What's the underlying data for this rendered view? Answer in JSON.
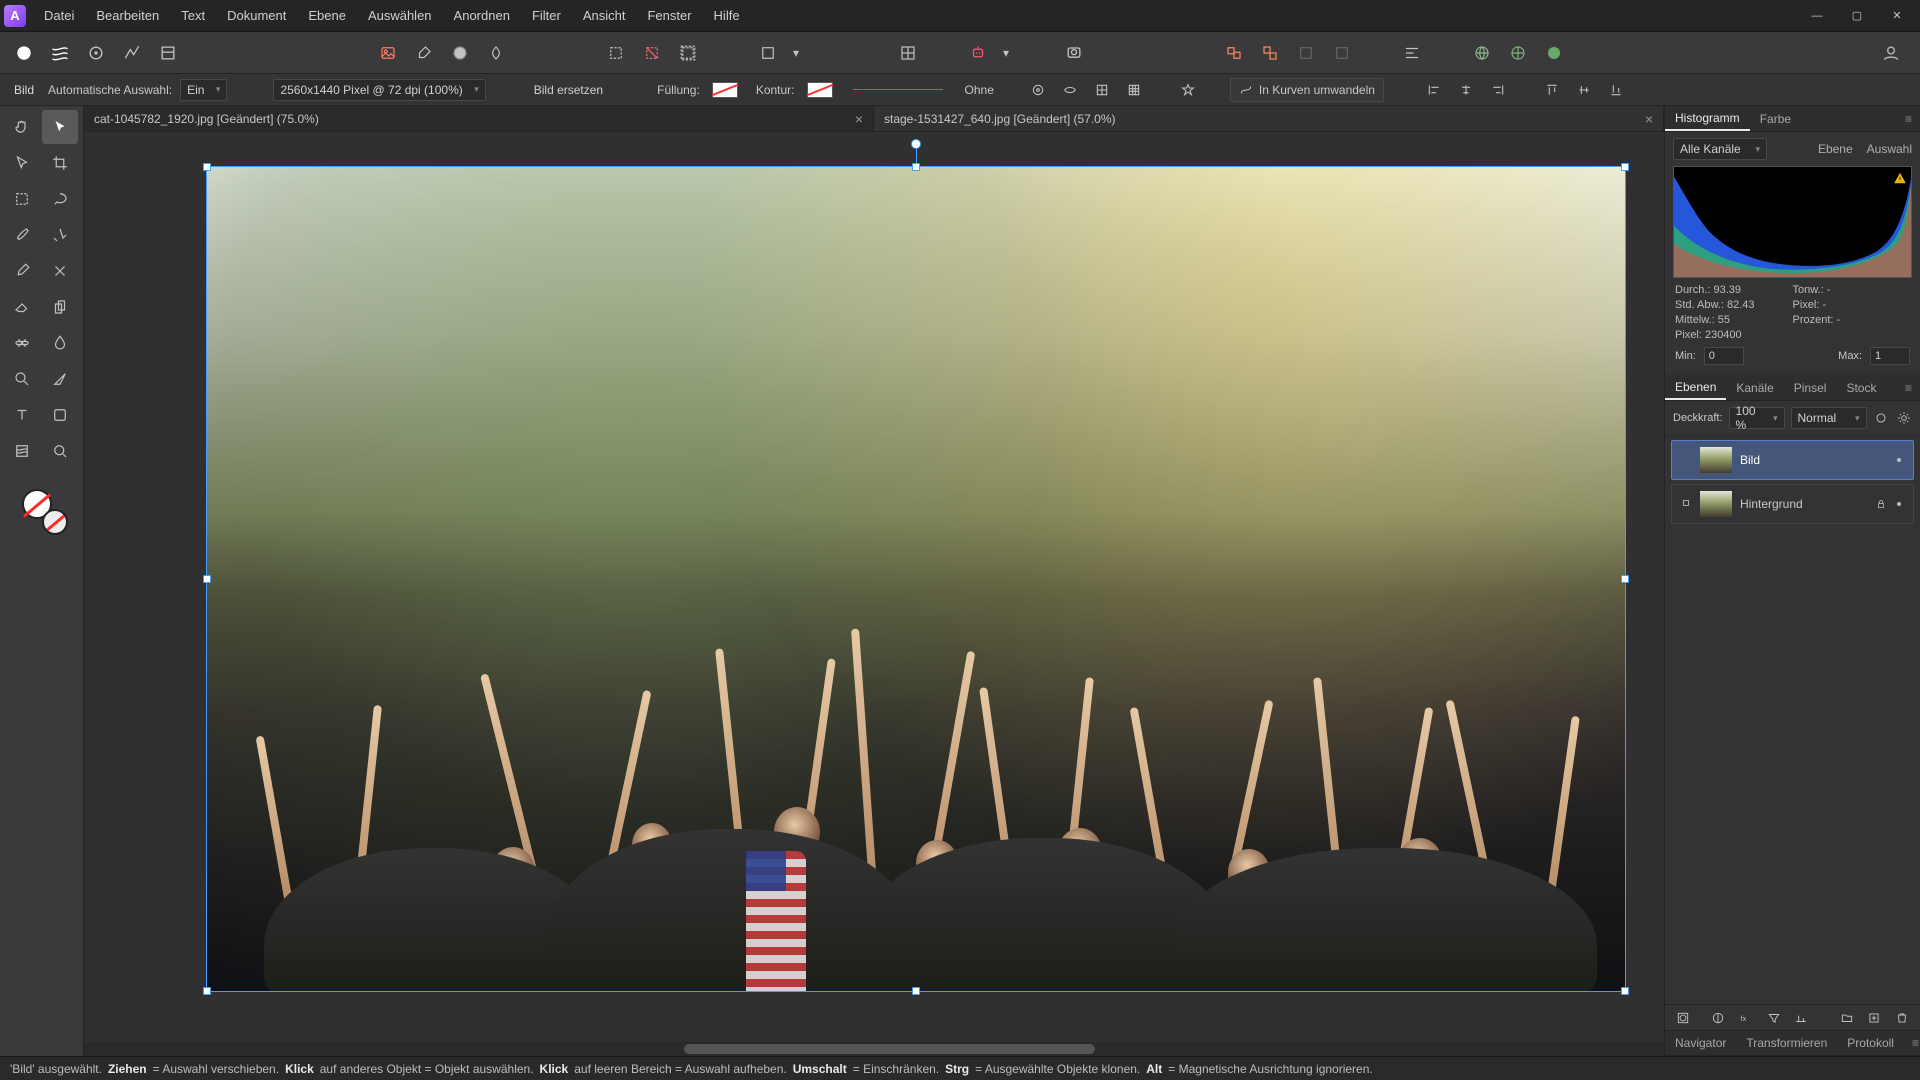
{
  "menubar": {
    "items": [
      "Datei",
      "Bearbeiten",
      "Text",
      "Dokument",
      "Ebene",
      "Auswählen",
      "Anordnen",
      "Filter",
      "Ansicht",
      "Fenster",
      "Hilfe"
    ]
  },
  "context_bar": {
    "tool_label": "Bild",
    "auto_select_label": "Automatische Auswahl:",
    "auto_select_value": "Ein",
    "resolution": "2560x1440 Pixel @ 72 dpi (100%)",
    "replace_image": "Bild ersetzen",
    "fill_label": "Füllung:",
    "stroke_label": "Kontur:",
    "stroke_none": "Ohne",
    "convert_to_curves": "In Kurven umwandeln"
  },
  "doc_tabs": [
    {
      "title": "cat-1045782_1920.jpg [Geändert] (75.0%)"
    },
    {
      "title": "stage-1531427_640.jpg [Geändert] (57.0%)"
    }
  ],
  "histogram_panel": {
    "tabs": [
      "Histogramm",
      "Farbe"
    ],
    "channel": "Alle Kanäle",
    "link_ebene": "Ebene",
    "link_auswahl": "Auswahl",
    "stats": {
      "durch": "Durch.: 93.39",
      "tonw": "Tonw.: -",
      "std": "Std. Abw.: 82.43",
      "pixel_label": "Pixel: -",
      "mittelw": "Mittelw.: 55",
      "prozent": "Prozent: -",
      "pixel": "Pixel: 230400"
    },
    "min_label": "Min:",
    "min_value": "0",
    "max_label": "Max:",
    "max_value": "1"
  },
  "layers_panel": {
    "tabs": [
      "Ebenen",
      "Kanäle",
      "Pinsel",
      "Stock"
    ],
    "opacity_label": "Deckkraft:",
    "opacity_value": "100 %",
    "blend_mode": "Normal",
    "layers": [
      {
        "name": "Bild",
        "selected": true,
        "locked": false,
        "visible": true
      },
      {
        "name": "Hintergrund",
        "selected": false,
        "locked": true,
        "visible": true
      }
    ]
  },
  "footer_panel": {
    "tabs": [
      "Navigator",
      "Transformieren",
      "Protokoll"
    ]
  },
  "statusbar": {
    "raw": "'Bild' ausgewählt. Ziehen = Auswahl verschieben. Klick auf anderes Objekt = Objekt auswählen. Klick auf leeren Bereich = Auswahl aufheben. Umschalt = Einschränken. Strg = Ausgewählte Objekte klonen. Alt = Magnetische Ausrichtung ignorieren.",
    "parts": {
      "p0": "'Bild' ausgewählt. ",
      "k1": "Ziehen",
      "p1": " = Auswahl verschieben. ",
      "k2": "Klick",
      "p2": " auf anderes Objekt = Objekt auswählen. ",
      "k3": "Klick",
      "p3": " auf leeren Bereich = Auswahl aufheben. ",
      "k4": "Umschalt",
      "p4": " = Einschränken. ",
      "k5": "Strg",
      "p5": " = Ausgewählte Objekte klonen. ",
      "k6": "Alt",
      "p6": " = Magnetische Ausrichtung ignorieren."
    }
  },
  "app_glyph": "A"
}
